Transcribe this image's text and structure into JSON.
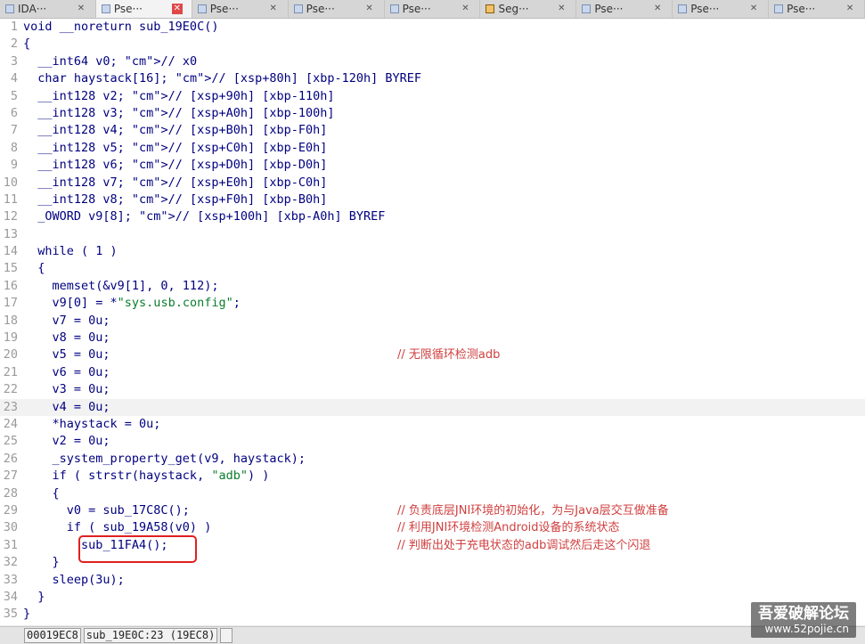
{
  "tabs": [
    {
      "label": "IDA···",
      "icon": "doc",
      "active": false
    },
    {
      "label": "Pse···",
      "icon": "doc",
      "active": true
    },
    {
      "label": "Pse···",
      "icon": "doc",
      "active": false
    },
    {
      "label": "Pse···",
      "icon": "doc",
      "active": false
    },
    {
      "label": "Pse···",
      "icon": "doc",
      "active": false
    },
    {
      "label": "Seg···",
      "icon": "seg",
      "active": false
    },
    {
      "label": "Pse···",
      "icon": "doc",
      "active": false
    },
    {
      "label": "Pse···",
      "icon": "doc",
      "active": false
    },
    {
      "label": "Pse···",
      "icon": "doc",
      "active": false
    }
  ],
  "lines": [
    {
      "n": "1",
      "code": "void __noreturn sub_19E0C()"
    },
    {
      "n": "2",
      "code": "{"
    },
    {
      "n": "3",
      "code": "  __int64 v0; // x0"
    },
    {
      "n": "4",
      "code": "  char haystack[16]; // [xsp+80h] [xbp-120h] BYREF"
    },
    {
      "n": "5",
      "code": "  __int128 v2; // [xsp+90h] [xbp-110h]"
    },
    {
      "n": "6",
      "code": "  __int128 v3; // [xsp+A0h] [xbp-100h]"
    },
    {
      "n": "7",
      "code": "  __int128 v4; // [xsp+B0h] [xbp-F0h]"
    },
    {
      "n": "8",
      "code": "  __int128 v5; // [xsp+C0h] [xbp-E0h]"
    },
    {
      "n": "9",
      "code": "  __int128 v6; // [xsp+D0h] [xbp-D0h]"
    },
    {
      "n": "10",
      "code": "  __int128 v7; // [xsp+E0h] [xbp-C0h]"
    },
    {
      "n": "11",
      "code": "  __int128 v8; // [xsp+F0h] [xbp-B0h]"
    },
    {
      "n": "12",
      "code": "  _OWORD v9[8]; // [xsp+100h] [xbp-A0h] BYREF"
    },
    {
      "n": "13",
      "code": ""
    },
    {
      "n": "14",
      "code": "  while ( 1 )"
    },
    {
      "n": "15",
      "code": "  {"
    },
    {
      "n": "16",
      "code": "    memset(&v9[1], 0, 112);"
    },
    {
      "n": "17",
      "code": "    v9[0] = *\"sys.usb.config\";"
    },
    {
      "n": "18",
      "code": "    v7 = 0u;"
    },
    {
      "n": "19",
      "code": "    v8 = 0u;"
    },
    {
      "n": "20",
      "code": "    v5 = 0u;",
      "comment": "// 无限循环检测adb"
    },
    {
      "n": "21",
      "code": "    v6 = 0u;"
    },
    {
      "n": "22",
      "code": "    v3 = 0u;"
    },
    {
      "n": "23",
      "code": "    v4 = 0u;",
      "highlight": true
    },
    {
      "n": "24",
      "code": "    *haystack = 0u;"
    },
    {
      "n": "25",
      "code": "    v2 = 0u;"
    },
    {
      "n": "26",
      "code": "    _system_property_get(v9, haystack);"
    },
    {
      "n": "27",
      "code": "    if ( strstr(haystack, \"adb\") )"
    },
    {
      "n": "28",
      "code": "    {"
    },
    {
      "n": "29",
      "code": "      v0 = sub_17C8C();",
      "comment": "// 负责底层JNI环境的初始化，为与Java层交互做准备"
    },
    {
      "n": "30",
      "code": "      if ( sub_19A58(v0) )",
      "comment": "// 利用JNI环境检测Android设备的系统状态"
    },
    {
      "n": "31",
      "code": "        sub_11FA4();",
      "comment": "// 判断出处于充电状态的adb调试然后走这个闪退"
    },
    {
      "n": "32",
      "code": "    }"
    },
    {
      "n": "33",
      "code": "    sleep(3u);"
    },
    {
      "n": "34",
      "code": "  }"
    },
    {
      "n": "35",
      "code": "}"
    }
  ],
  "status": {
    "address": "00019EC8",
    "location": "sub_19E0C:23 (19EC8)"
  },
  "watermark": {
    "line1": "吾爱破解论坛",
    "line2": "www.52pojie.cn"
  }
}
